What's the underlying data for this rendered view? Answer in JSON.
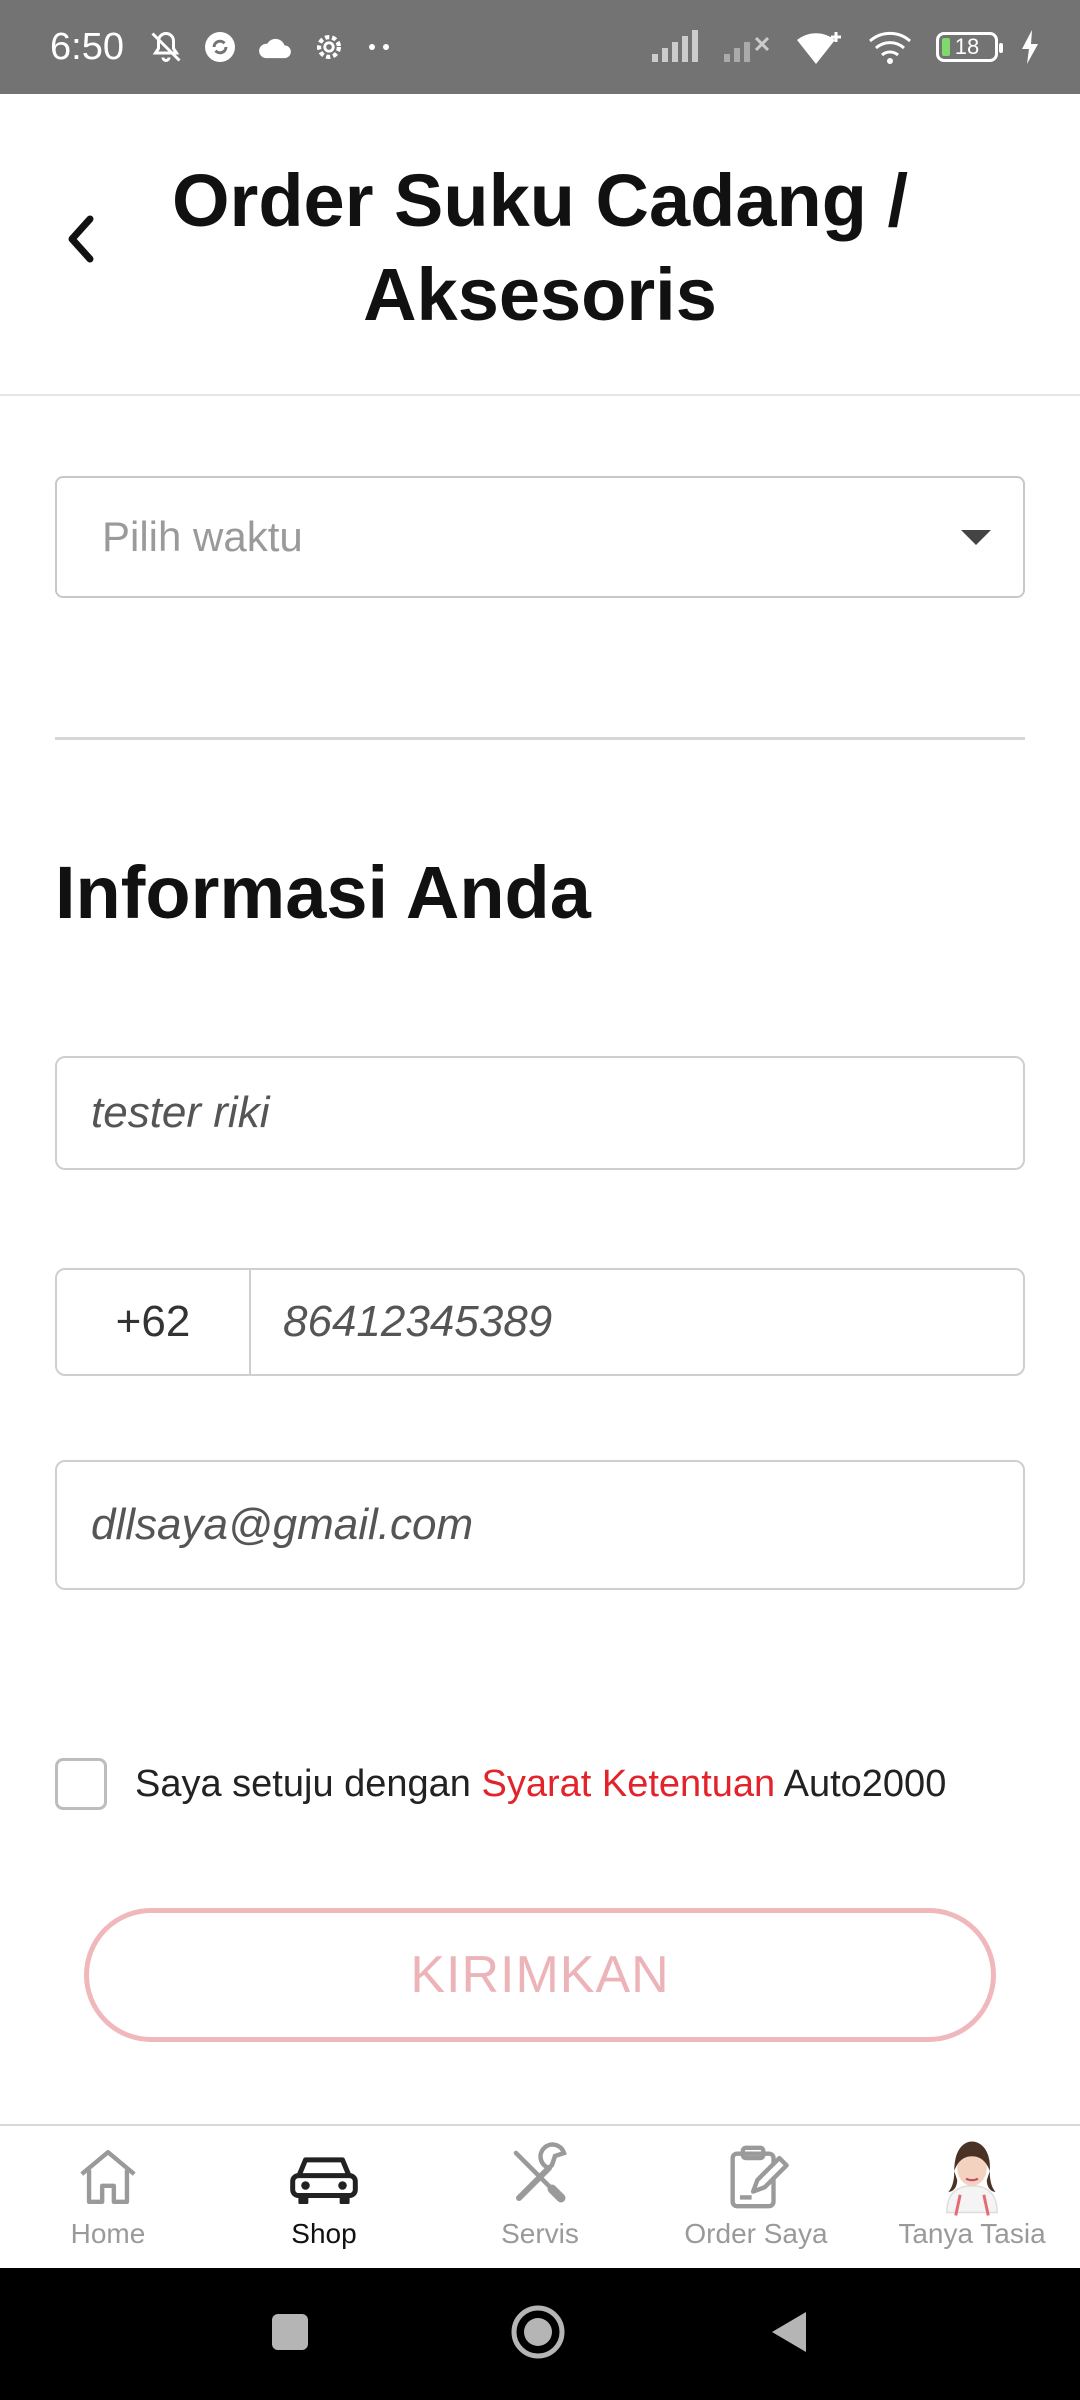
{
  "status_bar": {
    "time": "6:50",
    "battery_level": "18",
    "icons": [
      "mute-icon",
      "sync-icon",
      "cloud-icon",
      "settings-icon",
      "more-dots-icon",
      "signal-icon",
      "no-signal-icon",
      "wifi-plus-icon",
      "wifi-icon",
      "battery-icon",
      "charging-icon"
    ]
  },
  "header": {
    "title": "Order Suku Cadang / Aksesoris",
    "back_icon": "chevron-left-icon"
  },
  "time_select": {
    "placeholder": "Pilih waktu"
  },
  "info_section": {
    "title": "Informasi Anda",
    "name_value": "tester riki",
    "phone_code": "+62",
    "phone_value": "86412345389",
    "email_value": "dllsaya@gmail.com"
  },
  "agreement": {
    "checked": false,
    "text_before": "Saya setuju dengan ",
    "link_text": "Syarat Ketentuan",
    "text_after": " Auto2000"
  },
  "submit": {
    "label": "KIRIMKAN"
  },
  "bottom_nav": {
    "items": [
      {
        "label": "Home",
        "icon": "home-icon",
        "active": false
      },
      {
        "label": "Shop",
        "icon": "car-icon",
        "active": true
      },
      {
        "label": "Servis",
        "icon": "tools-icon",
        "active": false
      },
      {
        "label": "Order Saya",
        "icon": "clipboard-edit-icon",
        "active": false
      },
      {
        "label": "Tanya Tasia",
        "icon": "assistant-avatar-icon",
        "active": false
      }
    ]
  },
  "colors": {
    "accent_red": "#e2232a",
    "button_disabled_border": "#f0b8bc",
    "status_bar": "#737373"
  }
}
